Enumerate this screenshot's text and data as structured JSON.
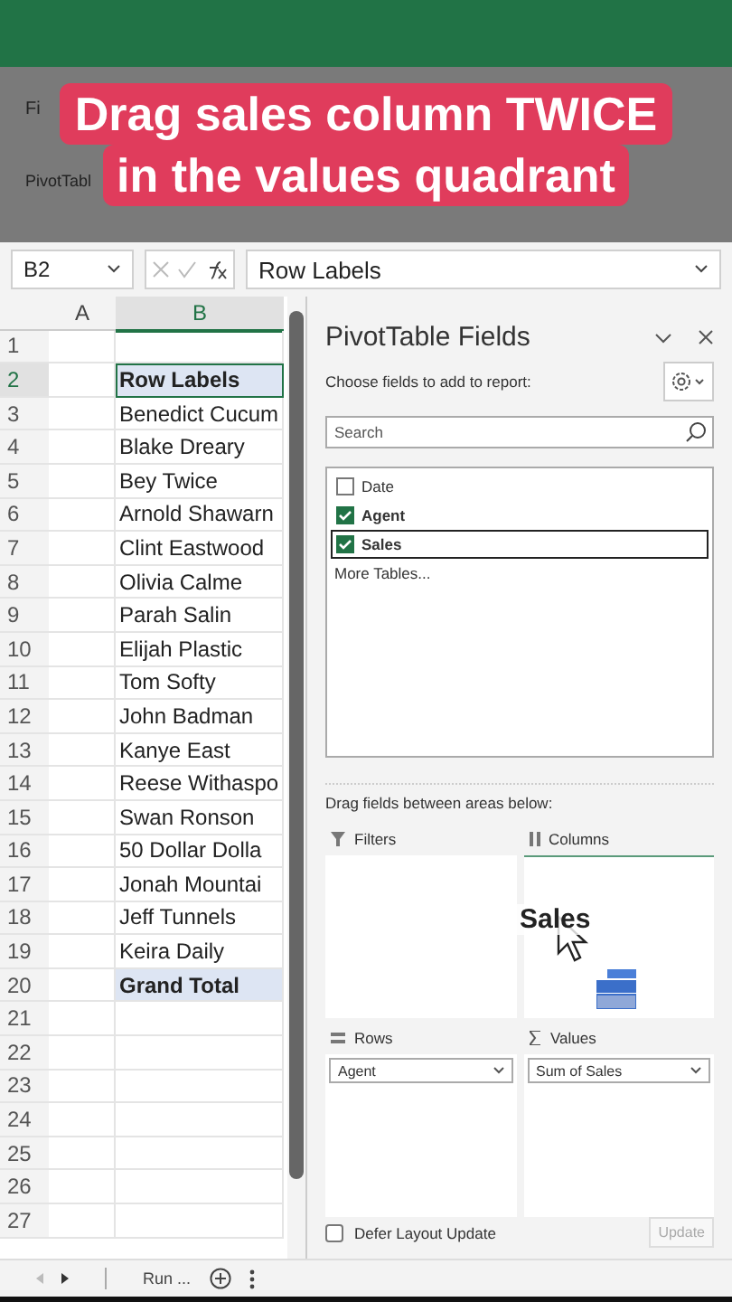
{
  "caption": {
    "lines": [
      "Drag sales column TWICE",
      "in the values quadrant"
    ]
  },
  "ribbon": {
    "tab_label": "Fi",
    "button_label": "PivotTabl"
  },
  "formula_bar": {
    "name_box": "B2",
    "formula": "Row Labels"
  },
  "sheet": {
    "columns": [
      "A",
      "B"
    ],
    "rows": [
      {
        "number": "1"
      },
      {
        "number": "2",
        "value": "Row Labels",
        "kind": "header"
      },
      {
        "number": "3",
        "value": "Benedict Cucum",
        "kind": "plain"
      },
      {
        "number": "4",
        "value": "Blake Dreary",
        "kind": "plain"
      },
      {
        "number": "5",
        "value": "Bey Twice",
        "kind": "plain"
      },
      {
        "number": "6",
        "value": "Arnold Shawarn",
        "kind": "plain"
      },
      {
        "number": "7",
        "value": "Clint Eastwood",
        "kind": "plain"
      },
      {
        "number": "8",
        "value": "Olivia Calme",
        "kind": "plain"
      },
      {
        "number": "9",
        "value": "Parah Salin",
        "kind": "plain"
      },
      {
        "number": "10",
        "value": "Elijah Plastic",
        "kind": "plain"
      },
      {
        "number": "11",
        "value": "Tom Softy",
        "kind": "plain"
      },
      {
        "number": "12",
        "value": "John Badman",
        "kind": "plain"
      },
      {
        "number": "13",
        "value": "Kanye East",
        "kind": "plain"
      },
      {
        "number": "14",
        "value": "Reese Withaspo",
        "kind": "plain"
      },
      {
        "number": "15",
        "value": "Swan Ronson",
        "kind": "plain"
      },
      {
        "number": "16",
        "value": "50 Dollar Dolla",
        "kind": "plain"
      },
      {
        "number": "17",
        "value": "Jonah Mountai",
        "kind": "plain"
      },
      {
        "number": "18",
        "value": "Jeff Tunnels",
        "kind": "plain"
      },
      {
        "number": "19",
        "value": "Keira Daily",
        "kind": "plain"
      },
      {
        "number": "20",
        "value": "Grand Total",
        "kind": "header"
      },
      {
        "number": "21"
      },
      {
        "number": "22"
      },
      {
        "number": "23"
      },
      {
        "number": "24"
      },
      {
        "number": "25"
      },
      {
        "number": "26"
      },
      {
        "number": "27"
      }
    ],
    "sheet_tab": "Run ..."
  },
  "pivot_panel": {
    "title": "PivotTable Fields",
    "subtitle": "Choose fields to add to report:",
    "search": {
      "placeholder": "Search"
    },
    "fields": [
      {
        "label": "Date",
        "checked": false,
        "selected": false
      },
      {
        "label": "Agent",
        "checked": true,
        "selected": false
      },
      {
        "label": "Sales",
        "checked": true,
        "selected": true
      }
    ],
    "more_tables": "More Tables...",
    "areas_hint": "Drag fields between areas below:",
    "areas": [
      {
        "kind": "filters",
        "label": "Filters"
      },
      {
        "kind": "columns",
        "label": "Columns"
      },
      {
        "kind": "rows",
        "label": "Rows",
        "items": [
          "Agent"
        ]
      },
      {
        "kind": "values",
        "label": "Values",
        "items": [
          "Sum of Sales"
        ]
      }
    ],
    "drag_ghost": "Sales",
    "defer_update": {
      "label": "Defer Layout Update",
      "checked": false
    },
    "update_button": "Update"
  }
}
